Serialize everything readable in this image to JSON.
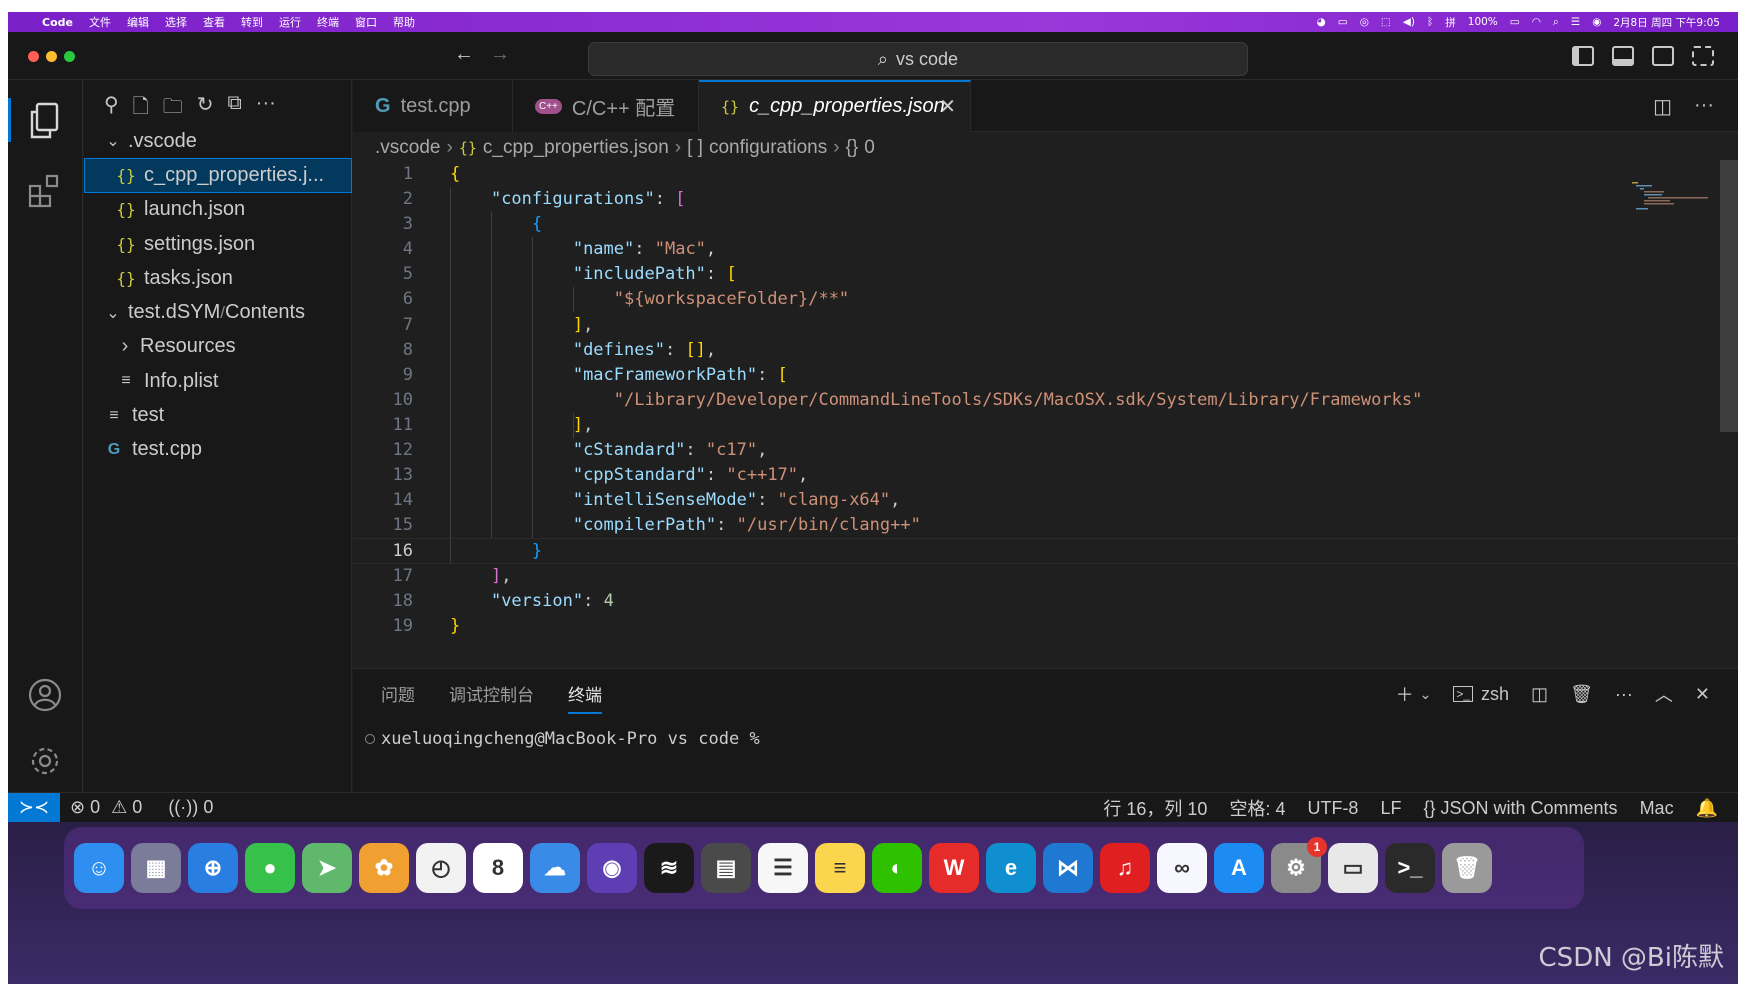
{
  "menubar": {
    "apple": "",
    "app": "Code",
    "items": [
      "文件",
      "编辑",
      "选择",
      "查看",
      "转到",
      "运行",
      "终端",
      "窗口",
      "帮助"
    ],
    "battery": "100%",
    "datetime": "2月8日 周四 下午9:05"
  },
  "titlebar": {
    "search": "vs code"
  },
  "sidebar": {
    "tree": [
      {
        "label": ".vscode",
        "type": "folder-open",
        "indent": 0
      },
      {
        "label": "c_cpp_properties.j...",
        "type": "json",
        "indent": 1,
        "selected": true
      },
      {
        "label": "launch.json",
        "type": "json",
        "indent": 1
      },
      {
        "label": "settings.json",
        "type": "json",
        "indent": 1
      },
      {
        "label": "tasks.json",
        "type": "json",
        "indent": 1
      },
      {
        "label": "test.dSYM",
        "label2": "Contents",
        "type": "folder-open",
        "indent": 0
      },
      {
        "label": "Resources",
        "type": "folder-closed",
        "indent": 1
      },
      {
        "label": "Info.plist",
        "type": "lines",
        "indent": 1
      },
      {
        "label": "test",
        "type": "lines",
        "indent": 0
      },
      {
        "label": "test.cpp",
        "type": "cpp",
        "indent": 0
      }
    ]
  },
  "tabs": [
    {
      "label": "test.cpp",
      "icon": "cpp-icon"
    },
    {
      "label": "C/C++ 配置",
      "icon": "cpp-config-icon"
    },
    {
      "label": "c_cpp_properties.json",
      "icon": "json-icon",
      "active": true
    }
  ],
  "breadcrumb": [
    {
      "label": ".vscode"
    },
    {
      "label": "c_cpp_properties.json",
      "icon": "{}"
    },
    {
      "label": "configurations",
      "icon": "[ ]"
    },
    {
      "label": "0",
      "icon": "{}"
    }
  ],
  "code": {
    "current_line": 16,
    "lines": [
      [
        [
          "b1",
          "{"
        ]
      ],
      [
        [
          "p",
          "    "
        ],
        [
          "k",
          "\"configurations\""
        ],
        [
          "p",
          ": "
        ],
        [
          "b2",
          "["
        ]
      ],
      [
        [
          "p",
          "        "
        ],
        [
          "b3",
          "{"
        ]
      ],
      [
        [
          "p",
          "            "
        ],
        [
          "k",
          "\"name\""
        ],
        [
          "p",
          ": "
        ],
        [
          "s",
          "\"Mac\""
        ],
        [
          "p",
          ","
        ]
      ],
      [
        [
          "p",
          "            "
        ],
        [
          "k",
          "\"includePath\""
        ],
        [
          "p",
          ": "
        ],
        [
          "b1",
          "["
        ]
      ],
      [
        [
          "p",
          "                "
        ],
        [
          "s",
          "\"${workspaceFolder}/**\""
        ]
      ],
      [
        [
          "p",
          "            "
        ],
        [
          "b1",
          "]"
        ],
        [
          "p",
          ","
        ]
      ],
      [
        [
          "p",
          "            "
        ],
        [
          "k",
          "\"defines\""
        ],
        [
          "p",
          ": "
        ],
        [
          "b1",
          "[]"
        ],
        [
          "p",
          ","
        ]
      ],
      [
        [
          "p",
          "            "
        ],
        [
          "k",
          "\"macFrameworkPath\""
        ],
        [
          "p",
          ": "
        ],
        [
          "b1",
          "["
        ]
      ],
      [
        [
          "p",
          "                "
        ],
        [
          "s",
          "\"/Library/Developer/CommandLineTools/SDKs/MacOSX.sdk/System/Library/Frameworks\""
        ]
      ],
      [
        [
          "p",
          "            "
        ],
        [
          "b1",
          "]"
        ],
        [
          "p",
          ","
        ]
      ],
      [
        [
          "p",
          "            "
        ],
        [
          "k",
          "\"cStandard\""
        ],
        [
          "p",
          ": "
        ],
        [
          "s",
          "\"c17\""
        ],
        [
          "p",
          ","
        ]
      ],
      [
        [
          "p",
          "            "
        ],
        [
          "k",
          "\"cppStandard\""
        ],
        [
          "p",
          ": "
        ],
        [
          "s",
          "\"c++17\""
        ],
        [
          "p",
          ","
        ]
      ],
      [
        [
          "p",
          "            "
        ],
        [
          "k",
          "\"intelliSenseMode\""
        ],
        [
          "p",
          ": "
        ],
        [
          "s",
          "\"clang-x64\""
        ],
        [
          "p",
          ","
        ]
      ],
      [
        [
          "p",
          "            "
        ],
        [
          "k",
          "\"compilerPath\""
        ],
        [
          "p",
          ": "
        ],
        [
          "s",
          "\"/usr/bin/clang++\""
        ]
      ],
      [
        [
          "p",
          "        "
        ],
        [
          "b3",
          "}"
        ]
      ],
      [
        [
          "p",
          "    "
        ],
        [
          "b2",
          "]"
        ],
        [
          "p",
          ","
        ]
      ],
      [
        [
          "p",
          "    "
        ],
        [
          "k",
          "\"version\""
        ],
        [
          "p",
          ": "
        ],
        [
          "n",
          "4"
        ]
      ],
      [
        [
          "b1",
          "}"
        ]
      ]
    ]
  },
  "panel": {
    "tabs": [
      "问题",
      "调试控制台",
      "终端"
    ],
    "active_tab": "终端",
    "shell": "zsh",
    "prompt": "xueluoqingcheng@MacBook-Pro vs code %"
  },
  "statusbar": {
    "errors": "0",
    "warnings": "0",
    "ports": "0",
    "position": "行 16，列 10",
    "spaces": "空格: 4",
    "encoding": "UTF-8",
    "eol": "LF",
    "language": "JSON with Comments",
    "config": "Mac"
  },
  "dock": [
    {
      "name": "finder",
      "color": "#2e8ff0",
      "glyph": "☺"
    },
    {
      "name": "launchpad",
      "color": "#7b7b9a",
      "glyph": "▦"
    },
    {
      "name": "safari",
      "color": "#2a7de1",
      "glyph": "⊕"
    },
    {
      "name": "messages",
      "color": "#36c24a",
      "glyph": "●"
    },
    {
      "name": "maps",
      "color": "#5fb86b",
      "glyph": "➤"
    },
    {
      "name": "photos",
      "color": "#f0a030",
      "glyph": "✿"
    },
    {
      "name": "clock",
      "color": "#f2f2f2",
      "glyph": "◴"
    },
    {
      "name": "calendar",
      "color": "#ffffff",
      "glyph": "8"
    },
    {
      "name": "weather",
      "color": "#3a8be8",
      "glyph": "☁"
    },
    {
      "name": "siri",
      "color": "#5d3fb3",
      "glyph": "◉"
    },
    {
      "name": "voice-memos",
      "color": "#1a1a1a",
      "glyph": "≋"
    },
    {
      "name": "calculator",
      "color": "#4a4a4a",
      "glyph": "▤"
    },
    {
      "name": "reminders",
      "color": "#f7f7f7",
      "glyph": "☰"
    },
    {
      "name": "notes",
      "color": "#fbd54d",
      "glyph": "≡"
    },
    {
      "name": "wechat",
      "color": "#2dc100",
      "glyph": "◐"
    },
    {
      "name": "huawei-app",
      "color": "#e62b2b",
      "glyph": "W"
    },
    {
      "name": "edge",
      "color": "#0f8fd0",
      "glyph": "e"
    },
    {
      "name": "vscode",
      "color": "#1f78d1",
      "glyph": "⋈"
    },
    {
      "name": "netease-music",
      "color": "#e02020",
      "glyph": "♫"
    },
    {
      "name": "baidu-netdisk",
      "color": "#f7f7ff",
      "glyph": "∞"
    },
    {
      "name": "app-store",
      "color": "#1d8cf2",
      "glyph": "A"
    },
    {
      "name": "system-settings",
      "color": "#8a8a8a",
      "glyph": "⚙",
      "badge": "1"
    },
    {
      "name": "printer",
      "color": "#e8e8e8",
      "glyph": "▭"
    },
    {
      "name": "terminal",
      "color": "#2a2a2a",
      "glyph": ">_"
    },
    {
      "name": "trash",
      "color": "#9a9a9a",
      "glyph": "🗑"
    }
  ],
  "watermark": "CSDN @Bi陈默"
}
